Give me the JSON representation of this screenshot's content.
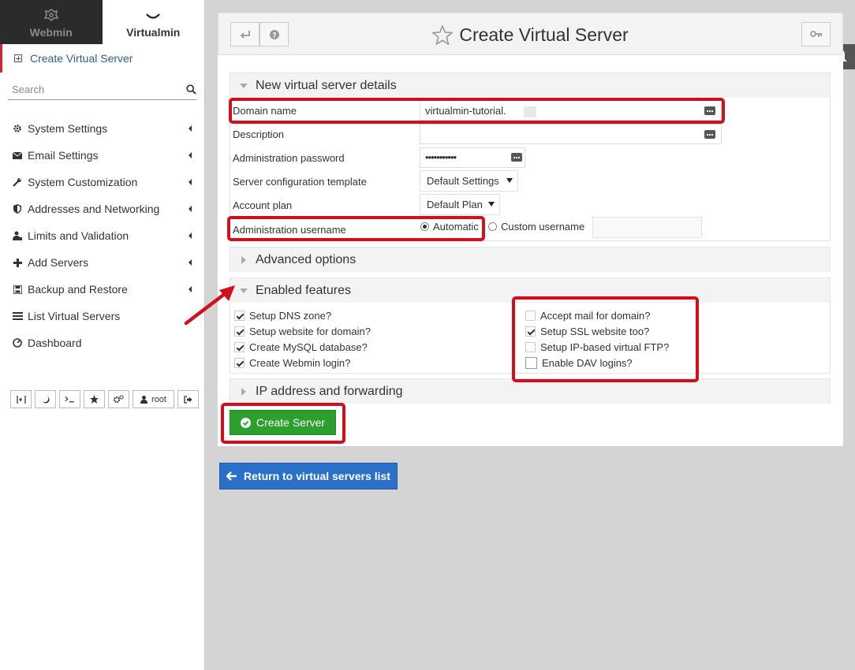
{
  "tabs": [
    {
      "label": "Webmin",
      "icon": "webmin-logo-icon"
    },
    {
      "label": "Virtualmin",
      "icon": "chevron-down-icon"
    }
  ],
  "sidebar": {
    "active_item": "Create Virtual Server",
    "search_placeholder": "Search",
    "items": [
      {
        "label": "System Settings",
        "icon": "gear-icon"
      },
      {
        "label": "Email Settings",
        "icon": "envelope-icon"
      },
      {
        "label": "System Customization",
        "icon": "wrench-icon"
      },
      {
        "label": "Addresses and Networking",
        "icon": "shield-icon"
      },
      {
        "label": "Limits and Validation",
        "icon": "user-lock-icon"
      },
      {
        "label": "Add Servers",
        "icon": "plus-icon"
      },
      {
        "label": "Backup and Restore",
        "icon": "floppy-icon"
      },
      {
        "label": "List Virtual Servers",
        "icon": "list-icon"
      },
      {
        "label": "Dashboard",
        "icon": "dashboard-icon"
      }
    ],
    "toolbar_user": "root"
  },
  "header": {
    "title": "Create Virtual Server"
  },
  "sections": {
    "details": "New virtual server details",
    "advanced": "Advanced options",
    "features": "Enabled features",
    "ip": "IP address and forwarding"
  },
  "form": {
    "domain_label": "Domain name",
    "domain_value": "virtualmin-tutorial.",
    "description_label": "Description",
    "description_value": "",
    "password_label": "Administration password",
    "password_value": "•••••••••••",
    "template_label": "Server configuration template",
    "template_value": "Default Settings",
    "plan_label": "Account plan",
    "plan_value": "Default Plan",
    "username_label": "Administration username",
    "username_auto": "Automatic",
    "username_custom": "Custom username"
  },
  "features": {
    "left": [
      {
        "label": "Setup DNS zone?",
        "checked": true
      },
      {
        "label": "Setup website for domain?",
        "checked": true
      },
      {
        "label": "Create MySQL database?",
        "checked": true
      },
      {
        "label": "Create Webmin login?",
        "checked": true
      }
    ],
    "right": [
      {
        "label": "Accept mail for domain?",
        "checked": false
      },
      {
        "label": "Setup SSL website too?",
        "checked": true
      },
      {
        "label": "Setup IP-based virtual FTP?",
        "checked": false
      },
      {
        "label": "Enable DAV logins?",
        "checked": false
      }
    ]
  },
  "buttons": {
    "create": "Create Server",
    "return": "Return to virtual servers list"
  },
  "colors": {
    "highlight_red": "#d0101b",
    "create_green": "#2ca02c",
    "return_blue": "#2a70c8"
  }
}
